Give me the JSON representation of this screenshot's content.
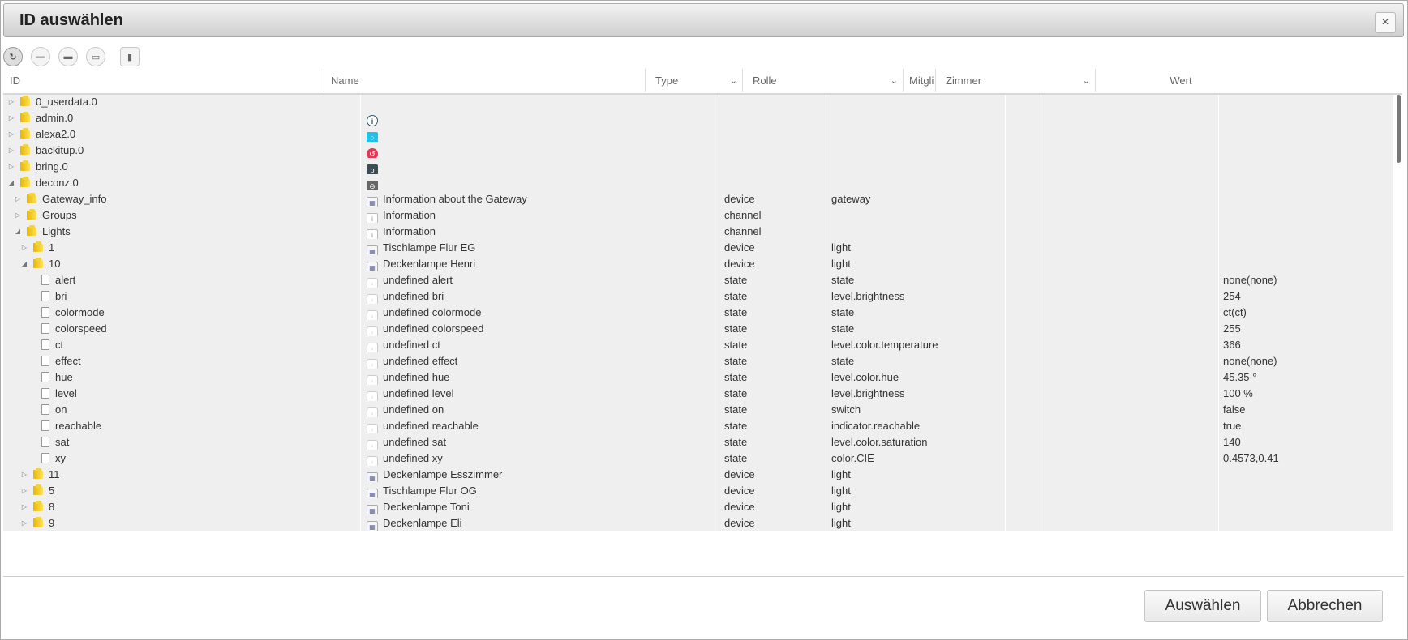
{
  "dialog": {
    "title": "ID auswählen",
    "close_label": "×",
    "select_label": "Auswählen",
    "cancel_label": "Abbrechen"
  },
  "toolbar": {
    "buttons": [
      {
        "icon": "refresh-icon",
        "glyph": "↻",
        "active": true
      },
      {
        "icon": "collapse-icon",
        "glyph": "—",
        "active": false
      },
      {
        "icon": "folder-closed-icon",
        "glyph": "▬",
        "active": false
      },
      {
        "icon": "folder-open-icon",
        "glyph": "▭",
        "active": false
      },
      {
        "icon": "columns-icon",
        "glyph": "▮",
        "active": false
      }
    ]
  },
  "columns": {
    "id": "ID",
    "name": "Name",
    "type": "Type",
    "role": "Rolle",
    "members": "Mitgli",
    "room": "Zimmer",
    "value": "Wert"
  },
  "rows": [
    {
      "level": 0,
      "kind": "folder",
      "toggle": "closed",
      "id": "0_userdata.0",
      "icon": "",
      "name": "",
      "type": "",
      "role": "",
      "value": ""
    },
    {
      "level": 0,
      "kind": "folder",
      "toggle": "closed",
      "id": "admin.0",
      "icon": "admin",
      "name": "",
      "type": "",
      "role": "",
      "value": ""
    },
    {
      "level": 0,
      "kind": "folder",
      "toggle": "closed",
      "id": "alexa2.0",
      "icon": "alexa",
      "name": "",
      "type": "",
      "role": "",
      "value": ""
    },
    {
      "level": 0,
      "kind": "folder",
      "toggle": "closed",
      "id": "backitup.0",
      "icon": "backitup",
      "name": "",
      "type": "",
      "role": "",
      "value": ""
    },
    {
      "level": 0,
      "kind": "folder",
      "toggle": "closed",
      "id": "bring.0",
      "icon": "bring",
      "name": "",
      "type": "",
      "role": "",
      "value": ""
    },
    {
      "level": 0,
      "kind": "folder",
      "toggle": "open",
      "id": "deconz.0",
      "icon": "deconz",
      "name": "",
      "type": "",
      "role": "",
      "value": ""
    },
    {
      "level": 1,
      "kind": "folder",
      "toggle": "closed",
      "id": "Gateway_info",
      "icon": "dev",
      "name": "Information about the Gateway",
      "type": "device",
      "role": "gateway",
      "value": ""
    },
    {
      "level": 1,
      "kind": "folder",
      "toggle": "closed",
      "id": "Groups",
      "icon": "chan",
      "name": "Information",
      "type": "channel",
      "role": "",
      "value": ""
    },
    {
      "level": 1,
      "kind": "folder",
      "toggle": "open",
      "id": "Lights",
      "icon": "chan",
      "name": "Information",
      "type": "channel",
      "role": "",
      "value": ""
    },
    {
      "level": 2,
      "kind": "folder",
      "toggle": "closed",
      "id": "1",
      "icon": "dev",
      "name": "Tischlampe Flur EG",
      "type": "device",
      "role": "light",
      "value": ""
    },
    {
      "level": 2,
      "kind": "folder",
      "toggle": "open",
      "id": "10",
      "icon": "dev",
      "name": "Deckenlampe Henri",
      "type": "device",
      "role": "light",
      "value": ""
    },
    {
      "level": 3,
      "kind": "file",
      "toggle": "",
      "id": "alert",
      "icon": "state",
      "name": "undefined alert",
      "type": "state",
      "role": "state",
      "value": "none(none)"
    },
    {
      "level": 3,
      "kind": "file",
      "toggle": "",
      "id": "bri",
      "icon": "state",
      "name": "undefined bri",
      "type": "state",
      "role": "level.brightness",
      "value": "254"
    },
    {
      "level": 3,
      "kind": "file",
      "toggle": "",
      "id": "colormode",
      "icon": "state",
      "name": "undefined colormode",
      "type": "state",
      "role": "state",
      "value": "ct(ct)"
    },
    {
      "level": 3,
      "kind": "file",
      "toggle": "",
      "id": "colorspeed",
      "icon": "state",
      "name": "undefined colorspeed",
      "type": "state",
      "role": "state",
      "value": "255"
    },
    {
      "level": 3,
      "kind": "file",
      "toggle": "",
      "id": "ct",
      "icon": "state",
      "name": "undefined ct",
      "type": "state",
      "role": "level.color.temperature",
      "value": "366"
    },
    {
      "level": 3,
      "kind": "file",
      "toggle": "",
      "id": "effect",
      "icon": "state",
      "name": "undefined effect",
      "type": "state",
      "role": "state",
      "value": "none(none)"
    },
    {
      "level": 3,
      "kind": "file",
      "toggle": "",
      "id": "hue",
      "icon": "state",
      "name": "undefined hue",
      "type": "state",
      "role": "level.color.hue",
      "value": "45.35 °"
    },
    {
      "level": 3,
      "kind": "file",
      "toggle": "",
      "id": "level",
      "icon": "state",
      "name": "undefined level",
      "type": "state",
      "role": "level.brightness",
      "value": "100 %"
    },
    {
      "level": 3,
      "kind": "file",
      "toggle": "",
      "id": "on",
      "icon": "state",
      "name": "undefined on",
      "type": "state",
      "role": "switch",
      "value": "false"
    },
    {
      "level": 3,
      "kind": "file",
      "toggle": "",
      "id": "reachable",
      "icon": "state",
      "name": "undefined reachable",
      "type": "state",
      "role": "indicator.reachable",
      "value": "true"
    },
    {
      "level": 3,
      "kind": "file",
      "toggle": "",
      "id": "sat",
      "icon": "state",
      "name": "undefined sat",
      "type": "state",
      "role": "level.color.saturation",
      "value": "140"
    },
    {
      "level": 3,
      "kind": "file",
      "toggle": "",
      "id": "xy",
      "icon": "state",
      "name": "undefined xy",
      "type": "state",
      "role": "color.CIE",
      "value": "0.4573,0.41"
    },
    {
      "level": 2,
      "kind": "folder",
      "toggle": "closed",
      "id": "11",
      "icon": "dev",
      "name": "Deckenlampe Esszimmer",
      "type": "device",
      "role": "light",
      "value": ""
    },
    {
      "level": 2,
      "kind": "folder",
      "toggle": "closed",
      "id": "5",
      "icon": "dev",
      "name": "Tischlampe Flur OG",
      "type": "device",
      "role": "light",
      "value": ""
    },
    {
      "level": 2,
      "kind": "folder",
      "toggle": "closed",
      "id": "8",
      "icon": "dev",
      "name": "Deckenlampe Toni",
      "type": "device",
      "role": "light",
      "value": ""
    },
    {
      "level": 2,
      "kind": "folder",
      "toggle": "closed",
      "id": "9",
      "icon": "dev",
      "name": "Deckenlampe Eli",
      "type": "device",
      "role": "light",
      "value": ""
    }
  ]
}
